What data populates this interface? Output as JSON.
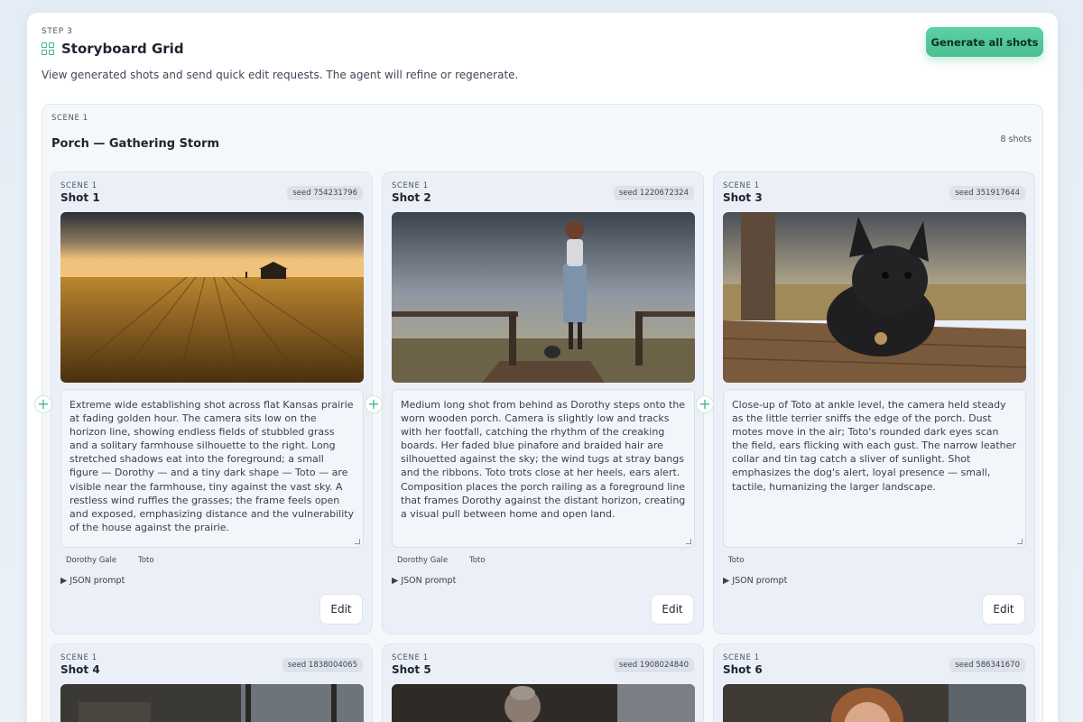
{
  "header": {
    "step": "STEP 3",
    "title": "Storyboard Grid",
    "subtitle": "View generated shots and send quick edit requests. The agent will refine or regenerate.",
    "generate_all_label": "Generate all shots"
  },
  "scene": {
    "label": "SCENE 1",
    "title": "Porch — Gathering Storm",
    "shot_count": "8 shots"
  },
  "shots": [
    {
      "scene": "SCENE 1",
      "title": "Shot 1",
      "seed": "seed 754231796",
      "prompt": "Extreme wide establishing shot across flat Kansas prairie at fading golden hour. The camera sits low on the horizon line, showing endless fields of stubbled grass and a solitary farmhouse silhouette to the right. Long stretched shadows eat into the foreground; a small figure — Dorothy — and a tiny dark shape — Toto — are visible near the farmhouse, tiny against the vast sky. A restless wind ruffles the grasses; the frame feels open and exposed, emphasizing distance and the vulnerability of the house against the prairie.",
      "tags": [
        "Dorothy Gale",
        "Toto"
      ],
      "json_label": "▶ JSON prompt",
      "edit_label": "Edit"
    },
    {
      "scene": "SCENE 1",
      "title": "Shot 2",
      "seed": "seed 1220672324",
      "prompt": "Medium long shot from behind as Dorothy steps onto the worn wooden porch. Camera is slightly low and tracks with her footfall, catching the rhythm of the creaking boards. Her faded blue pinafore and braided hair are silhouetted against the sky; the wind tugs at stray bangs and the ribbons. Toto trots close at her heels, ears alert. Composition places the porch railing as a foreground line that frames Dorothy against the distant horizon, creating a visual pull between home and open land.",
      "tags": [
        "Dorothy Gale",
        "Toto"
      ],
      "json_label": "▶ JSON prompt",
      "edit_label": "Edit"
    },
    {
      "scene": "SCENE 1",
      "title": "Shot 3",
      "seed": "seed 351917644",
      "prompt": "Close-up of Toto at ankle level, the camera held steady as the little terrier sniffs the edge of the porch. Dust motes move in the air; Toto's rounded dark eyes scan the field, ears flicking with each gust. The narrow leather collar and tin tag catch a sliver of sunlight. Shot emphasizes the dog's alert, loyal presence — small, tactile, humanizing the larger landscape.",
      "tags": [
        "Toto"
      ],
      "json_label": "▶ JSON prompt",
      "edit_label": "Edit"
    },
    {
      "scene": "SCENE 1",
      "title": "Shot 4",
      "seed": "seed 1838004065"
    },
    {
      "scene": "SCENE 1",
      "title": "Shot 5",
      "seed": "seed 1908024840"
    },
    {
      "scene": "SCENE 1",
      "title": "Shot 6",
      "seed": "seed 586341670"
    }
  ],
  "icons": {
    "grid": "grid-icon",
    "plus": "plus-icon",
    "accent": "#49bf92"
  }
}
